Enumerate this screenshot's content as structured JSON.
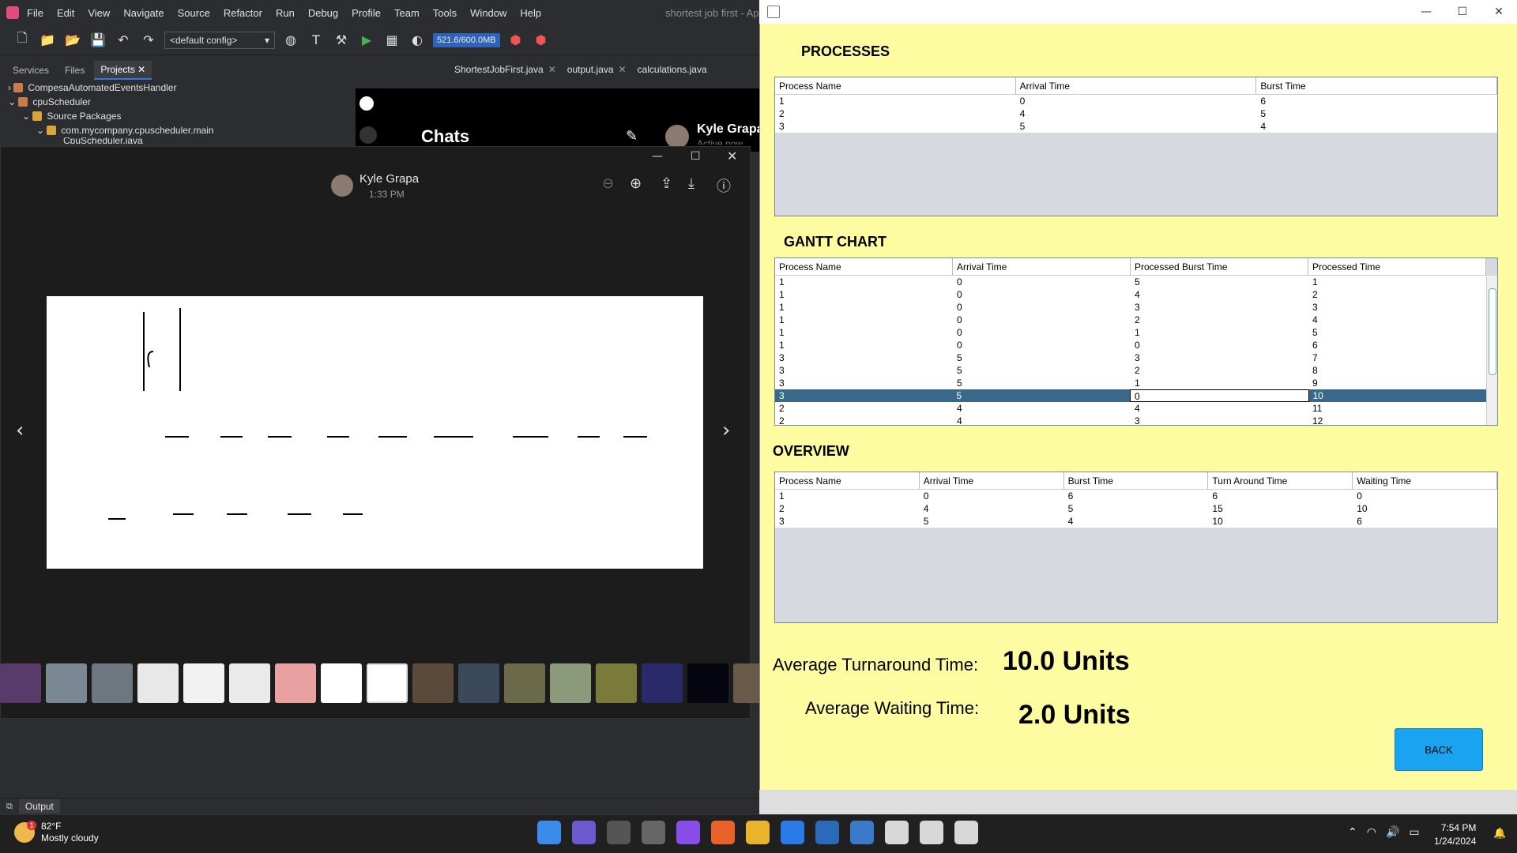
{
  "ide": {
    "menu": [
      "File",
      "Edit",
      "View",
      "Navigate",
      "Source",
      "Refactor",
      "Run",
      "Debug",
      "Profile",
      "Team",
      "Tools",
      "Window",
      "Help"
    ],
    "title": "shortest job first - Ap",
    "config": "<default config>",
    "memory": "521.6/600.0MB",
    "panel_tabs": [
      "Services",
      "Files",
      "Projects"
    ],
    "tree": [
      "CompesaAutomatedEventsHandler",
      "cpuScheduler",
      "Source Packages",
      "com.mycompany.cpuscheduler.main",
      "CpuScheduler.java"
    ],
    "editor_tabs": [
      "ShortestJobFirst.java",
      "output.java",
      "calculations.java"
    ],
    "output_tab": "Output"
  },
  "messenger": {
    "chats_title": "Chats",
    "contact_name": "Kyle Grapa",
    "contact_status": "Active now"
  },
  "viewer": {
    "sender": "Kyle Grapa",
    "time": "1:33 PM",
    "icons": [
      "zoom-out-icon",
      "zoom-in-icon",
      "share-icon",
      "download-icon",
      "info-icon"
    ]
  },
  "app": {
    "processes_title": "PROCESSES",
    "processes_headers": [
      "Process Name",
      "Arrival Time",
      "Burst Time"
    ],
    "processes_rows": [
      [
        "1",
        "0",
        "6"
      ],
      [
        "2",
        "4",
        "5"
      ],
      [
        "3",
        "5",
        "4"
      ]
    ],
    "gantt_title": "GANTT CHART",
    "gantt_headers": [
      "Process Name",
      "Arrival Time",
      "Processed Burst Time",
      "Processed Time"
    ],
    "gantt_rows": [
      [
        "1",
        "0",
        "5",
        "1"
      ],
      [
        "1",
        "0",
        "4",
        "2"
      ],
      [
        "1",
        "0",
        "3",
        "3"
      ],
      [
        "1",
        "0",
        "2",
        "4"
      ],
      [
        "1",
        "0",
        "1",
        "5"
      ],
      [
        "1",
        "0",
        "0",
        "6"
      ],
      [
        "3",
        "5",
        "3",
        "7"
      ],
      [
        "3",
        "5",
        "2",
        "8"
      ],
      [
        "3",
        "5",
        "1",
        "9"
      ],
      [
        "3",
        "5",
        "0",
        "10"
      ],
      [
        "2",
        "4",
        "4",
        "11"
      ],
      [
        "2",
        "4",
        "3",
        "12"
      ]
    ],
    "gantt_selected_index": 9,
    "overview_title": "OVERVIEW",
    "overview_headers": [
      "Process Name",
      "Arrival Time",
      "Burst Time",
      "Turn Around Time",
      "Waiting Time"
    ],
    "overview_rows": [
      [
        "1",
        "0",
        "6",
        "6",
        "0"
      ],
      [
        "2",
        "4",
        "5",
        "15",
        "10"
      ],
      [
        "3",
        "5",
        "4",
        "10",
        "6"
      ]
    ],
    "avg_turnaround_label": "Average Turnaround Time:",
    "avg_turnaround_value": "10.0 Units",
    "avg_waiting_label": "Average Waiting Time:",
    "avg_waiting_value": "2.0 Units",
    "back_label": "BACK"
  },
  "taskbar": {
    "temperature": "82°F",
    "weather": "Mostly cloudy",
    "weather_badge": "1",
    "time": "7:54 PM",
    "date": "1/24/2024"
  }
}
